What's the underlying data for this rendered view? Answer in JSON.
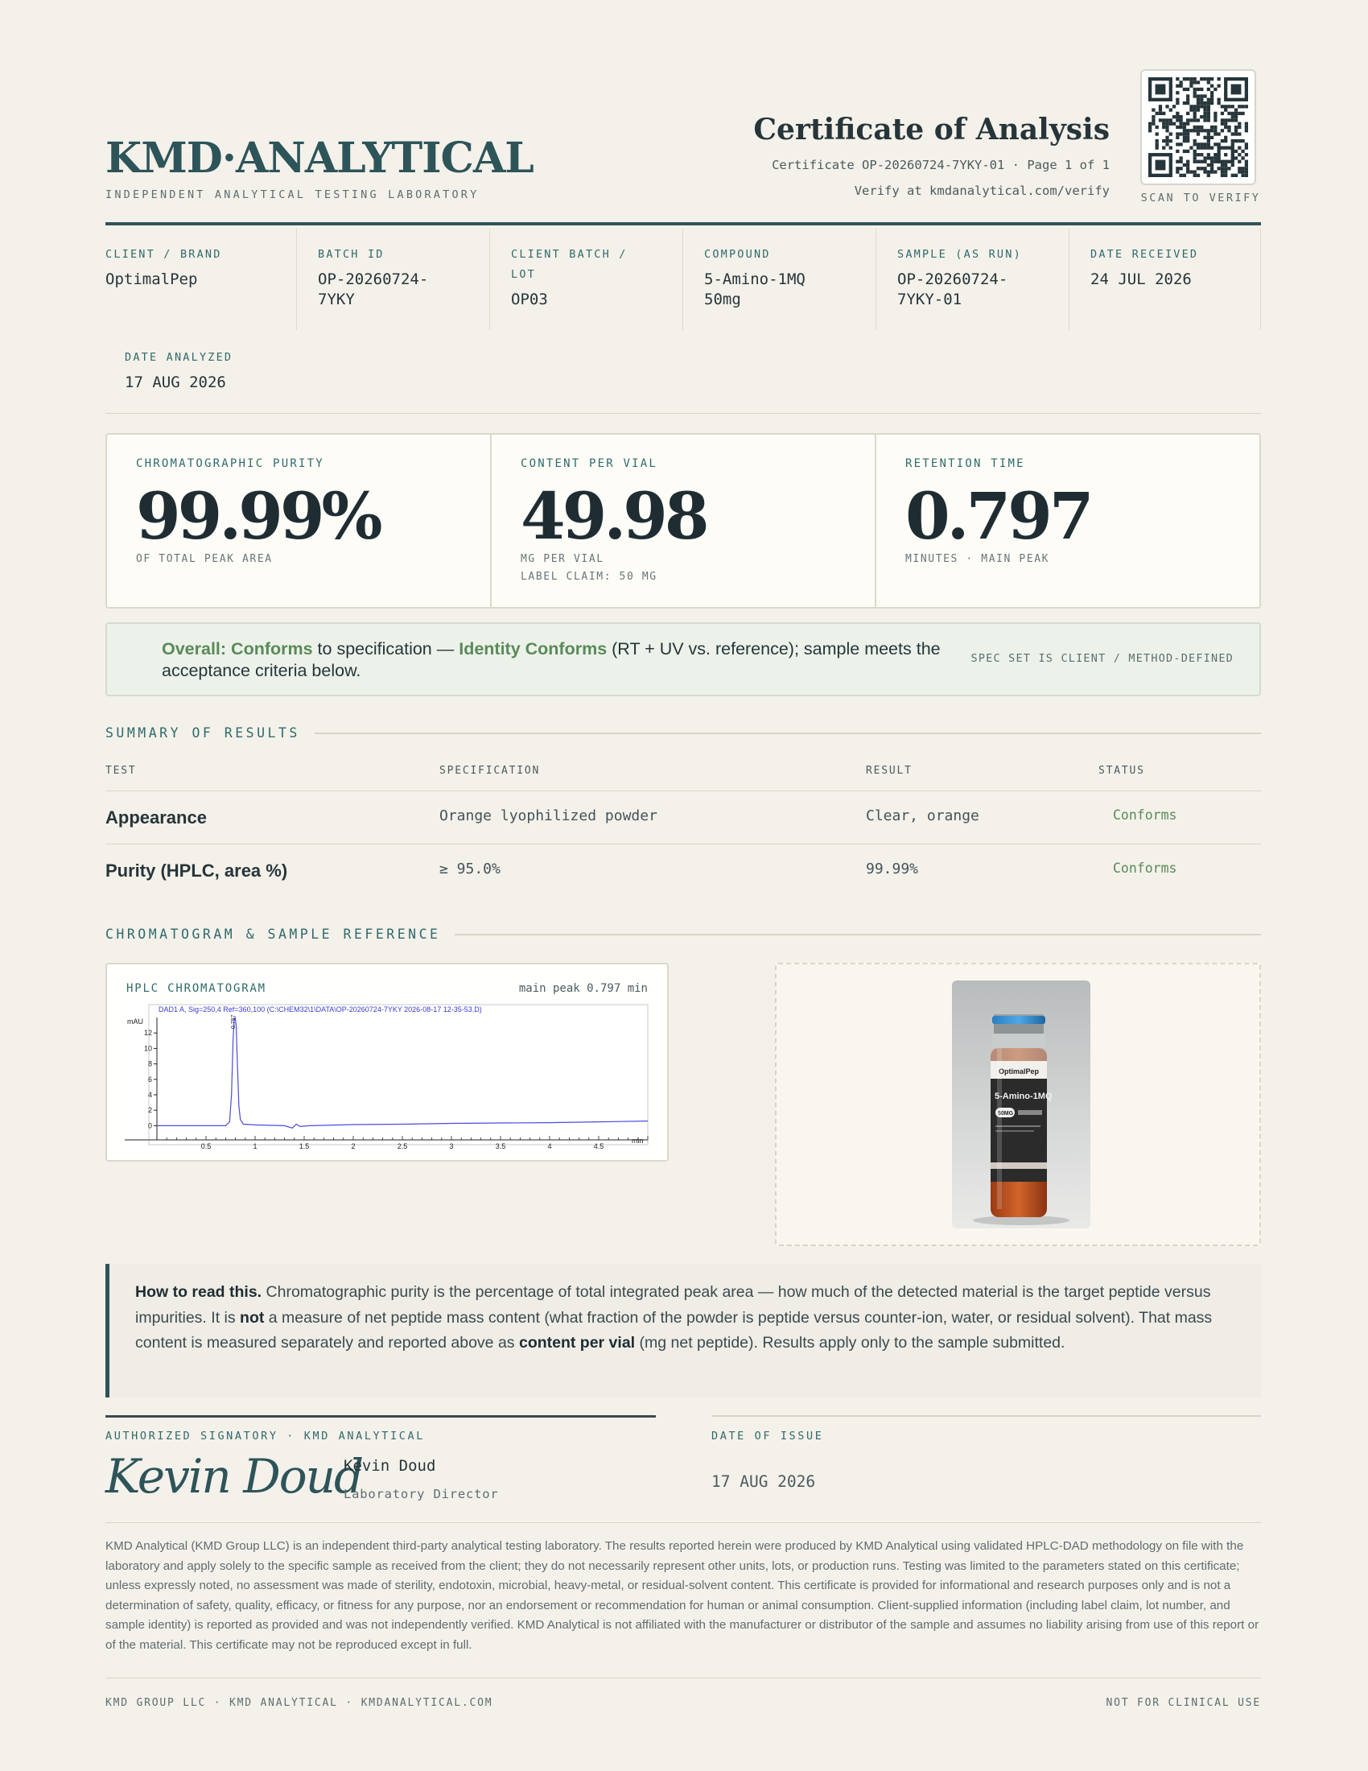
{
  "header": {
    "brand": "KMD·ANALYTICAL",
    "brand_subtitle": "INDEPENDENT ANALYTICAL TESTING LABORATORY",
    "title": "Certificate of Analysis",
    "certificate_line": "Certificate OP-20260724-7YKY-01 · Page 1 of 1",
    "verify_line": "Verify at kmdanalytical.com/verify",
    "qr_label": "SCAN TO VERIFY"
  },
  "info": [
    {
      "label": "CLIENT / BRAND",
      "value": "OptimalPep"
    },
    {
      "label": "BATCH ID",
      "value": "OP-20260724-7YKY"
    },
    {
      "label": "CLIENT BATCH / LOT",
      "value": "OP03"
    },
    {
      "label": "COMPOUND",
      "value": "5-Amino-1MQ 50mg"
    },
    {
      "label": "SAMPLE (AS RUN)",
      "value": "OP-20260724-7YKY-01"
    },
    {
      "label": "DATE RECEIVED",
      "value": "24 JUL 2026"
    },
    {
      "label": "DATE ANALYZED",
      "value": "17 AUG 2026"
    }
  ],
  "metrics": [
    {
      "label": "CHROMATOGRAPHIC PURITY",
      "value": "99.99%",
      "sub1": "OF TOTAL PEAK AREA",
      "sub2": ""
    },
    {
      "label": "CONTENT PER VIAL",
      "value": "49.98",
      "sub1": "MG PER VIAL",
      "sub2": "LABEL CLAIM: 50 MG"
    },
    {
      "label": "RETENTION TIME",
      "value": "0.797",
      "sub1": "MINUTES · MAIN PEAK",
      "sub2": ""
    }
  ],
  "overall": {
    "status": "Overall: Conforms",
    "text1": " to specification — ",
    "identity": "Identity Conforms",
    "text2": " (RT + UV vs. reference); sample meets the acceptance criteria below.",
    "note": "SPEC SET IS CLIENT / METHOD-DEFINED"
  },
  "summary": {
    "title": "SUMMARY OF RESULTS",
    "columns": [
      "TEST",
      "SPECIFICATION",
      "RESULT",
      "STATUS"
    ],
    "rows": [
      {
        "test": "Appearance",
        "spec": "Orange lyophilized powder",
        "result": "Clear, orange",
        "status": "Conforms"
      },
      {
        "test": "Purity (HPLC, area %)",
        "spec": "≥ 95.0%",
        "result": "99.99%",
        "status": "Conforms"
      }
    ]
  },
  "chromatogram": {
    "section_title": "CHROMATOGRAM & SAMPLE REFERENCE",
    "panel_title": "HPLC CHROMATOGRAM",
    "peak_note": "main peak 0.797 min",
    "signal_label": "DAD1 A, Sig=250,4 Ref=360,100 (C:\\CHEM32\\1\\DATA\\OP-20260724-7YKY 2026-08-17 12-35-53.D)",
    "y_unit": "mAU",
    "x_unit": "min",
    "peak_label": "0.797",
    "y_ticks": [
      "0",
      "2",
      "4",
      "6",
      "8",
      "10",
      "12"
    ],
    "x_ticks": [
      "0.5",
      "1",
      "1.5",
      "2",
      "2.5",
      "3",
      "3.5",
      "4",
      "4.5"
    ],
    "x_range": [
      0.0,
      5.0
    ],
    "y_range": [
      -1,
      14
    ],
    "trace": [
      [
        0.0,
        0.0
      ],
      [
        0.7,
        0.0
      ],
      [
        0.74,
        0.5
      ],
      [
        0.76,
        4.0
      ],
      [
        0.775,
        11.0
      ],
      [
        0.787,
        13.8
      ],
      [
        0.797,
        14.0
      ],
      [
        0.807,
        13.0
      ],
      [
        0.82,
        8.0
      ],
      [
        0.835,
        2.5
      ],
      [
        0.85,
        0.8
      ],
      [
        0.88,
        0.2
      ],
      [
        1.0,
        0.1
      ],
      [
        1.3,
        0.0
      ],
      [
        1.38,
        -0.3
      ],
      [
        1.42,
        0.2
      ],
      [
        1.46,
        -0.1
      ],
      [
        1.55,
        0.0
      ],
      [
        2.0,
        0.15
      ],
      [
        2.5,
        0.2
      ],
      [
        3.0,
        0.3
      ],
      [
        3.5,
        0.35
      ],
      [
        4.0,
        0.4
      ],
      [
        4.5,
        0.5
      ],
      [
        5.0,
        0.6
      ]
    ],
    "color": "#4a4ae0"
  },
  "vial": {
    "brand": "OptimalPep",
    "name": "5-Amino-1MQ",
    "dose": "50MG"
  },
  "howto": {
    "lead": "How to read this.",
    "t1": " Chromatographic purity is the percentage of total integrated peak area — how much of the detected material is the target peptide versus impurities. It is ",
    "not": "not",
    "t2": " a measure of net peptide mass content (what fraction of the powder is peptide versus counter-ion, water, or residual solvent). That mass content is measured separately and reported above as ",
    "cpv": "content per vial",
    "t3": " (mg net peptide). Results apply only to the sample submitted."
  },
  "signature": {
    "label": "AUTHORIZED SIGNATORY · KMD ANALYTICAL",
    "script": "Kevin Doud",
    "name": "Kevin Doud",
    "title": "Laboratory Director",
    "date_label": "DATE OF ISSUE",
    "date": "17 AUG 2026"
  },
  "disclaimer": "KMD Analytical (KMD Group LLC) is an independent third-party analytical testing laboratory. The results reported herein were produced by KMD Analytical using validated HPLC-DAD methodology on file with the laboratory and apply solely to the specific sample as received from the client; they do not necessarily represent other units, lots, or production runs. Testing was limited to the parameters stated on this certificate; unless expressly noted, no assessment was made of sterility, endotoxin, microbial, heavy-metal, or residual-solvent content. This certificate is provided for informational and research purposes only and is not a determination of safety, quality, efficacy, or fitness for any purpose, nor an endorsement or recommendation for human or animal consumption. Client-supplied information (including label claim, lot number, and sample identity) is reported as provided and was not independently verified. KMD Analytical is not affiliated with the manufacturer or distributor of the sample and assumes no liability arising from use of this report or of the material. This certificate may not be reproduced except in full.",
  "footer": {
    "left": "KMD GROUP LLC · KMD ANALYTICAL · KMDANALYTICAL.COM",
    "right": "NOT FOR CLINICAL USE"
  }
}
